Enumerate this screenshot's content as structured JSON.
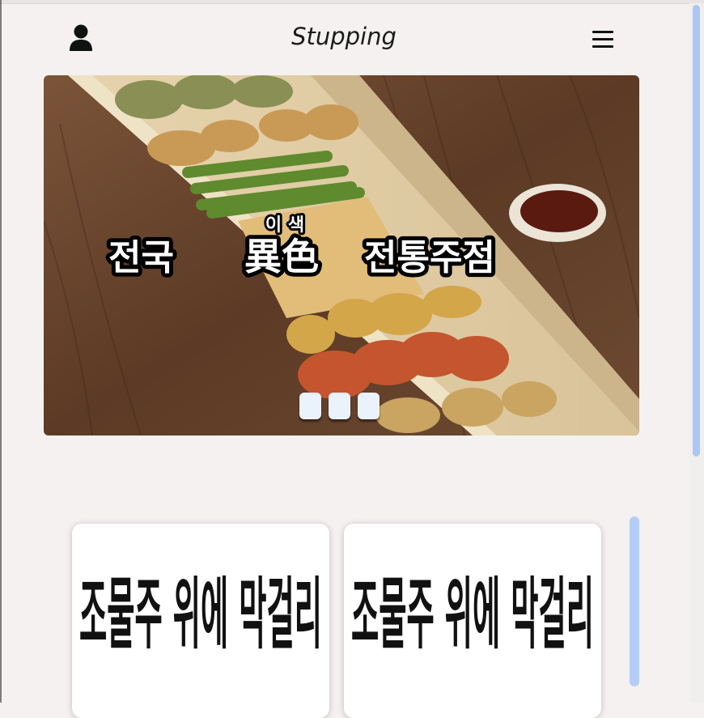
{
  "header": {
    "brand": "Stupping",
    "user_icon": "user-icon",
    "menu_icon": "hamburger-menu-icon"
  },
  "hero": {
    "ruby": "이 색",
    "title_parts": [
      "전국",
      "異色",
      "전통주점"
    ],
    "slide_count": 3
  },
  "products": [
    {
      "label": "조물주 위에 막걸리"
    },
    {
      "label": "조물주 위에 막걸리"
    }
  ],
  "colors": {
    "background": "#f4f1f0",
    "scrollbar": "#aac7f6",
    "dot": "#eaf2fb"
  }
}
